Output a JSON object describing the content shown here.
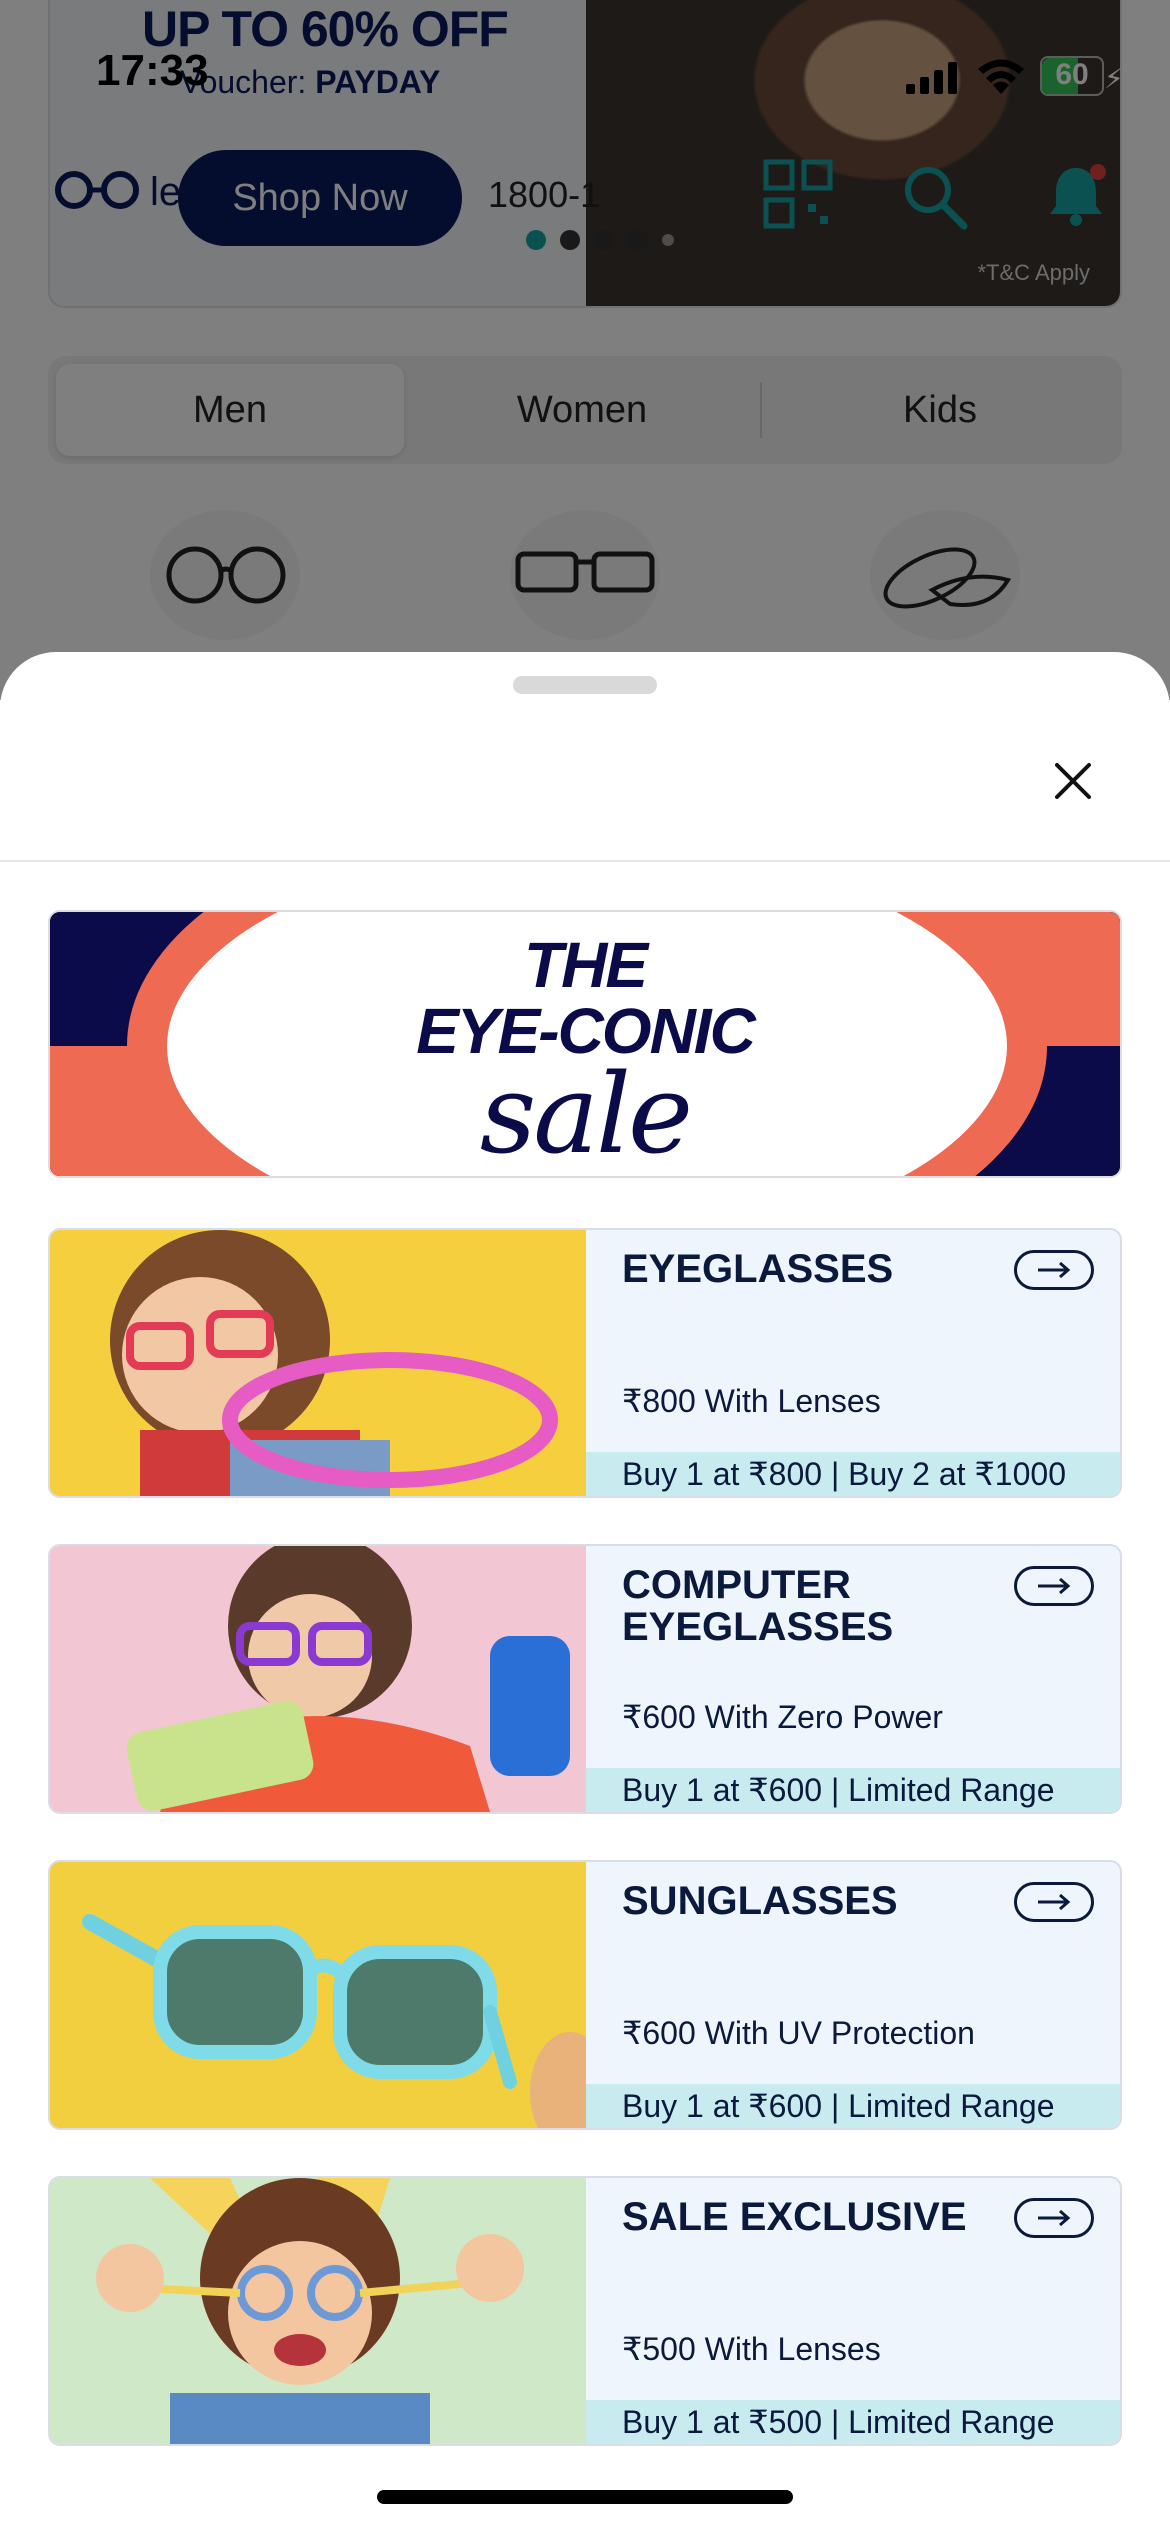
{
  "status_bar": {
    "time": "17:33",
    "battery": "60",
    "battery_level_percent": 60,
    "icons": [
      "signal-icon",
      "wifi-icon",
      "battery-icon",
      "charging-bolt-icon"
    ]
  },
  "background": {
    "promo": {
      "headline": "UP TO 60% OFF",
      "voucher_label": "Voucher: ",
      "voucher_code": "PAYDAY",
      "cta": "Shop Now",
      "disclaimer": "*T&C Apply",
      "carousel_dots": 5,
      "active_dot": 0
    },
    "topbar": {
      "brand": "le",
      "phone": "1800-1",
      "icons": [
        "lenskart-logo-icon",
        "qr-scan-icon",
        "search-icon",
        "bell-icon"
      ]
    },
    "tabs": [
      {
        "label": "Men",
        "active": true
      },
      {
        "label": "Women",
        "active": false
      },
      {
        "label": "Kids",
        "active": false
      }
    ],
    "category_icons": [
      "eyeglasses-icon",
      "screen-glasses-icon",
      "contact-lens-icon"
    ]
  },
  "sheet": {
    "close_icon": "close-icon",
    "sale_banner": {
      "line1": "THE",
      "line2": "EYE-CONIC",
      "line3": "sale",
      "colors": {
        "navy": "#0b0b4a",
        "coral": "#ef6a52"
      }
    },
    "cards": [
      {
        "title": "EYEGLASSES",
        "price": "₹800 With Lenses",
        "offer": "Buy 1 at ₹800 | Buy 2 at ₹1000",
        "photo_bg": "#f6cf3e"
      },
      {
        "title": "COMPUTER EYEGLASSES",
        "price": "₹600 With Zero Power",
        "offer": "Buy 1 at ₹600 | Limited Range",
        "photo_bg": "#f3c6d3"
      },
      {
        "title": "SUNGLASSES",
        "price": "₹600 With UV Protection",
        "offer": "Buy 1 at ₹600 | Limited Range",
        "photo_bg": "#f2cf3f"
      },
      {
        "title": "SALE EXCLUSIVE",
        "price": "₹500 With Lenses",
        "offer": "Buy 1 at ₹500 | Limited Range",
        "photo_bg": "#cfe8c8"
      }
    ]
  }
}
